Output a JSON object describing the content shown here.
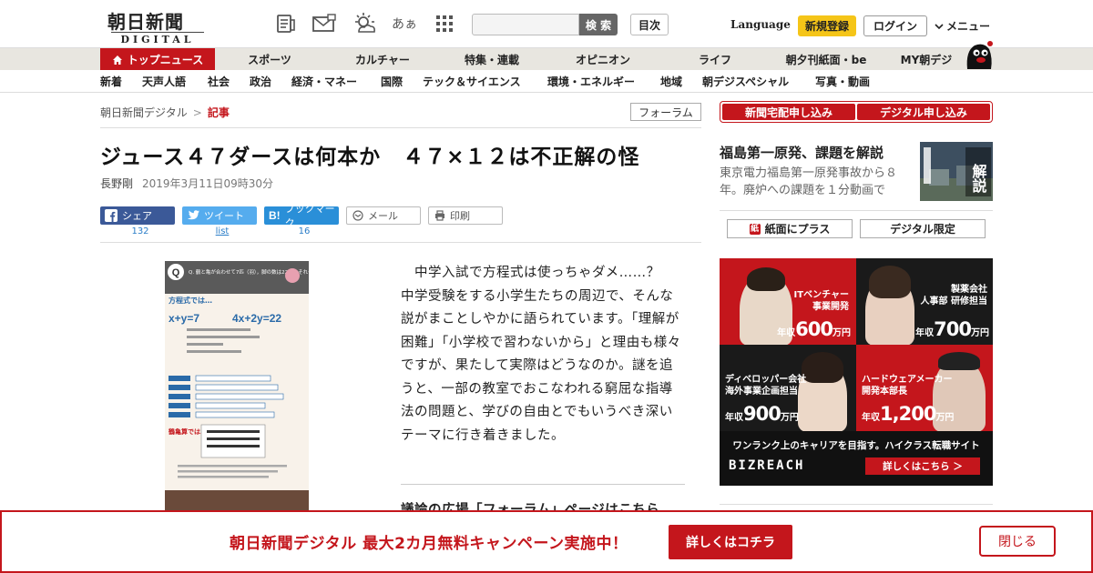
{
  "header": {
    "logo_text": "朝日新聞",
    "logo_sub": "DIGITAL",
    "icons": [
      "newspaper-icon",
      "mail-icon",
      "weather-icon",
      "font-size-icon",
      "grid-menu-icon"
    ],
    "font_icon_text": "あぁ",
    "search_button": "検 索",
    "toc_button": "目次",
    "language": "Language",
    "signup": "新規登録",
    "login": "ログイン",
    "menu": "メニュー"
  },
  "nav_primary": [
    "トップニュース",
    "スポーツ",
    "カルチャー",
    "特集・連載",
    "オピニオン",
    "ライフ",
    "朝夕刊紙面・be",
    "MY朝デジ"
  ],
  "nav_secondary": [
    "新着",
    "天声人語",
    "社会",
    "政治",
    "経済・マネー",
    "国際",
    "テック＆サイエンス",
    "環境・エネルギー",
    "地域",
    "朝デジスペシャル",
    "写真・動画"
  ],
  "breadcrumb": {
    "home": "朝日新聞デジタル",
    "separator": ">",
    "current": "記事"
  },
  "forum_tag": "フォーラム",
  "article": {
    "title": "ジュース４７ダースは何本か　４７×１２は不正解の怪",
    "author": "長野剛",
    "date": "2019年3月11日09時30分",
    "body": "　中学入試で方程式は使っちゃダメ……？　中学受験をする小学生たちの周辺で、そんな説がまことしやかに語られています。「理解が困難」「小学校で習わないから」と理由も様々ですが、果たして実際はどうなのか。謎を追うと、一部の教室でおこなわれる窮屈な指導法の問題と、学びの自由とでもいうべき深いテーマに行き着きました。",
    "subhead": "議論の広場「フォーラム」ページはこちら"
  },
  "share": {
    "facebook": "シェア",
    "facebook_count": "132",
    "twitter": "ツイート",
    "twitter_count": "list",
    "hatena": "ブックマーク",
    "hatena_count": "16",
    "mail": "メール",
    "print": "印刷"
  },
  "infographic": {
    "question": "Q. 鶴と亀が合わせて7匹（羽），脚の数は22本。それぞれ何匹？",
    "method_label": "方程式では…",
    "eq1": "x+y=7",
    "eq2": "4x+2y=22",
    "tsurukame_label": "鶴亀算では…"
  },
  "sidebar": {
    "btn_delivery": "新聞宅配申し込み",
    "btn_digital": "デジタル申し込み",
    "promo_title": "福島第一原発、課題を解説",
    "promo_text": "東京電力福島第一原発事故から８年。廃炉への課題を１分動画で",
    "promo_img_text": "解説",
    "tab_paper": "紙面にプラス",
    "tab_digital": "デジタル限定"
  },
  "ad": {
    "c1_label": "ITベンチャー\n事業開発",
    "c1_prefix": "年収",
    "c1_salary": "600",
    "c1_unit": "万円",
    "c2_label": "製薬会社\n人事部 研修担当",
    "c2_prefix": "年収",
    "c2_salary": "700",
    "c2_unit": "万円",
    "c3_label": "ディベロッパー会社\n海外事業企画担当",
    "c3_prefix": "年収",
    "c3_salary": "900",
    "c3_unit": "万円",
    "c4_label": "ハードウェアメーカー\n開発本部長",
    "c4_prefix": "年収",
    "c4_salary": "1,200",
    "c4_unit": "万円",
    "catch": "ワンランク上のキャリアを目指す。ハイクラス転職サイト",
    "brand": "BIZREACH",
    "more": "詳しくはこちら ＞"
  },
  "banner": {
    "text": "朝日新聞デジタル 最大2カ月無料キャンペーン実施中！",
    "button": "詳しくはコチラ",
    "close": "閉じる"
  },
  "colors": {
    "brand_red": "#c4161c",
    "facebook": "#3b5998",
    "twitter": "#55acee",
    "hatena": "#2a8fd8",
    "signup_yellow": "#f5c518"
  }
}
